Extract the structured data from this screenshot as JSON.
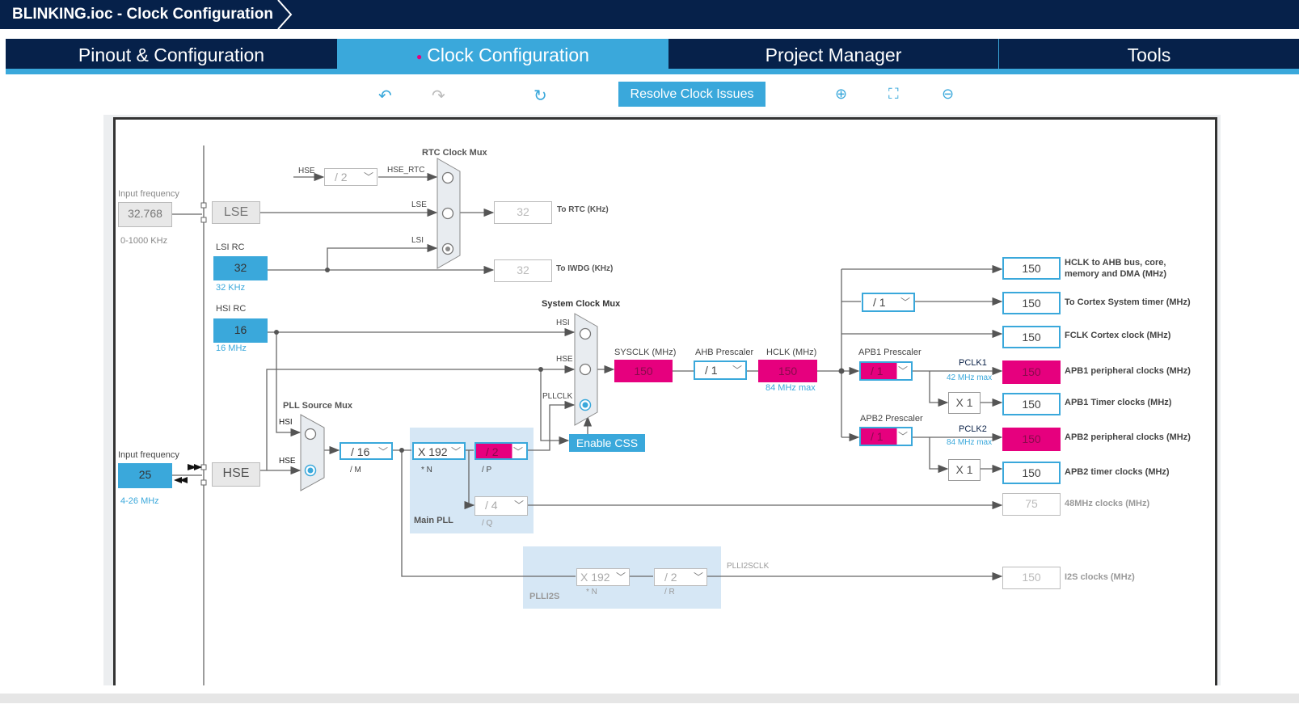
{
  "window": {
    "title": "BLINKING.ioc - Clock Configuration"
  },
  "tabs": [
    {
      "label": "Pinout & Configuration"
    },
    {
      "label": "Clock Configuration",
      "active": true
    },
    {
      "label": "Project Manager"
    },
    {
      "label": "Tools"
    }
  ],
  "toolbar": {
    "undo": "undo-icon",
    "redo": "redo-icon",
    "reset": "refresh-icon",
    "resolve_label": "Resolve Clock Issues",
    "zoom_in": "zoom-in-icon",
    "fit": "fit-icon",
    "zoom_out": "zoom-out-icon"
  },
  "colors": {
    "navy": "#06214a",
    "accent": "#3aa8db",
    "error": "#e6007e"
  },
  "lse": {
    "input_label": "Input frequency",
    "input_value": "32.768",
    "range": "0-1000 KHz",
    "name": "LSE"
  },
  "lsi": {
    "label": "LSI RC",
    "value": "32",
    "unit": "32 KHz"
  },
  "hsi": {
    "label": "HSI RC",
    "value": "16",
    "unit": "16 MHz"
  },
  "hse": {
    "input_label": "Input frequency",
    "input_value": "25",
    "range": "4-26 MHz",
    "name": "HSE"
  },
  "rtc": {
    "mux_label": "RTC Clock Mux",
    "hse_label": "HSE",
    "div_value": "/ 2",
    "hse_rtc": "HSE_RTC",
    "lse_label": "LSE",
    "lsi_label": "LSI",
    "rtc_value": "32",
    "rtc_label": "To RTC (KHz)",
    "iwdg_value": "32",
    "iwdg_label": "To IWDG (KHz)"
  },
  "sysmux": {
    "label": "System Clock Mux",
    "hsi": "HSI",
    "hse": "HSE",
    "pllclk": "PLLCLK",
    "selected": "PLLCLK",
    "css": "Enable CSS"
  },
  "pll": {
    "mux_label": "PLL Source Mux",
    "hsi": "HSI",
    "hse": "HSE",
    "selected": "HSE",
    "m_value": "/ 16",
    "m_label": "/ M",
    "n_value": "X 192",
    "n_label": "* N",
    "p_value": "/ 2",
    "p_label": "/ P",
    "q_value": "/ 4",
    "q_label": "/ Q",
    "name": "Main PLL"
  },
  "plli2s": {
    "n_value": "X 192",
    "n_label": "* N",
    "r_value": "/ 2",
    "r_label": "/ R",
    "name": "PLLI2S",
    "out_label": "PLLI2SCLK"
  },
  "sysclk": {
    "label": "SYSCLK (MHz)",
    "value": "150"
  },
  "ahb": {
    "label": "AHB Prescaler",
    "value": "/ 1"
  },
  "hclk": {
    "label": "HCLK (MHz)",
    "value": "150",
    "max": "84 MHz max"
  },
  "cortex_div": "/ 1",
  "apb1": {
    "label": "APB1 Prescaler",
    "value": "/ 1",
    "pclk": "PCLK1",
    "max": "42 MHz max",
    "timer_mult": "X 1"
  },
  "apb2": {
    "label": "APB2 Prescaler",
    "value": "/ 1",
    "pclk": "PCLK2",
    "max": "84 MHz max",
    "timer_mult": "X 1"
  },
  "outputs": [
    {
      "value": "150",
      "label": "HCLK to AHB bus, core, memory and DMA (MHz)"
    },
    {
      "value": "150",
      "label": "To Cortex System timer (MHz)"
    },
    {
      "value": "150",
      "label": "FCLK Cortex clock (MHz)"
    },
    {
      "value": "150",
      "label": "APB1 peripheral clocks (MHz)"
    },
    {
      "value": "150",
      "label": "APB1 Timer clocks (MHz)"
    },
    {
      "value": "150",
      "label": "APB2 peripheral clocks (MHz)"
    },
    {
      "value": "150",
      "label": "APB2 timer clocks (MHz)"
    },
    {
      "value": "75",
      "label": "48MHz clocks (MHz)"
    },
    {
      "value": "150",
      "label": "I2S clocks (MHz)"
    }
  ]
}
